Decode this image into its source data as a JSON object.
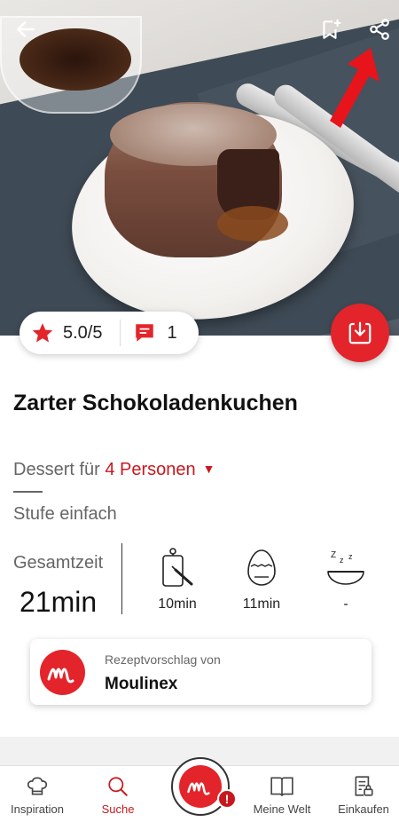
{
  "recipe": {
    "title": "Zarter Schokoladenkuchen",
    "rating": "5.0/5",
    "comments": "1",
    "category": "Dessert für",
    "persons": "4 Personen",
    "level": "Stufe einfach",
    "total_label": "Gesamtzeit",
    "total_value": "21min",
    "times": {
      "prep": "10min",
      "cook": "11min",
      "rest": "-"
    }
  },
  "suggestion": {
    "label": "Rezeptvorschlag von",
    "brand": "Moulinex"
  },
  "nav": {
    "inspiration": "Inspiration",
    "search": "Suche",
    "my_world": "Meine Welt",
    "shopping": "Einkaufen"
  },
  "badge": "!",
  "colors": {
    "accent": "#e3242b",
    "accent_text": "#c8181f"
  },
  "icons": [
    "back-arrow-icon",
    "bookmark-add-icon",
    "share-icon",
    "download-icon",
    "star-icon",
    "comment-icon",
    "cutting-board-icon",
    "egg-timer-icon",
    "sleep-bowl-icon",
    "chef-hat-icon",
    "search-icon",
    "book-icon",
    "shopping-list-icon"
  ]
}
